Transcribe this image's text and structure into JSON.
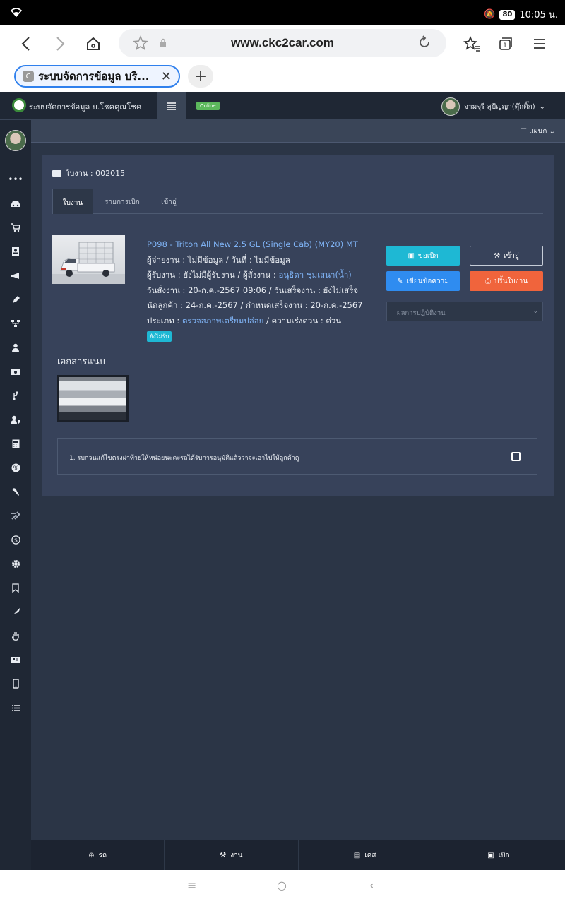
{
  "status": {
    "battery": "80",
    "time": "10:05 น."
  },
  "browser": {
    "url": "www.ckc2car.com",
    "tab_count": "1",
    "tab_title": "ระบบจัดการข้อมูล บริ...",
    "tab_favicon": "C"
  },
  "site": {
    "brand": "ระบบจัดการข้อมูล บ.โชคคุณโชค",
    "online": "Online",
    "user": "จามจุรี สุปัญญา(ตุ๊กติ๊ก)",
    "plan_label": "แผนก"
  },
  "job": {
    "header": "ใบงาน : 002015",
    "tabs": [
      "ใบงาน",
      "รายการเบิก",
      "เข้าอู่"
    ],
    "title": "P098 - Triton All New 2.5 GL (Single Cab) (MY20) MT",
    "line1": "ผู้จ่ายงาน : ไม่มีข้อมูล / วันที่ : ไม่มีข้อมูล",
    "line2_prefix": "ผู้รับงาน : ยังไม่มีผู้รับงาน / ผู้สั่งงาน : ",
    "line2_link": "อนุธิดา ชุมเสนา(น้ำ)",
    "line3": "วันสั่งงาน : 20-ก.ค.-2567 09:06 / วันเสร็จงาน : ยังไม่เสร็จ",
    "line4": "นัดลูกค้า : 24-ก.ค.-2567 / กำหนดเสร็จงาน : 20-ก.ค.-2567",
    "line5_prefix": "ประเภท : ",
    "line5_link": "ตรวจสภาพเตรียมปล่อย",
    "line5_suffix": " / ความเร่งด่วน : ด่วน",
    "badge": "ยังไม่รับ"
  },
  "actions": {
    "request": "ขอเบิก",
    "garage": "เข้าอู่",
    "write": "เขียนข้อความ",
    "print": "ปริ้นใบงาน",
    "result_placeholder": "ผลการปฏิบัติงาน"
  },
  "attachments": {
    "title": "เอกสารแนบ"
  },
  "notes": [
    "1. รบกวนแก้ไขตรงฝาท้ายให้หน่อยนะคะรถได้รับการอนุมัติแล้วว่าจะเอาไปให้ลูกค้าดู"
  ],
  "bottom_nav": [
    "รถ",
    "งาน",
    "เคส",
    "เบิก"
  ],
  "colors": {
    "cyan": "#1eb8d4",
    "blue": "#2f8cf0",
    "orange": "#f0643c",
    "dark": "#1f2734",
    "panel": "#37425a"
  }
}
